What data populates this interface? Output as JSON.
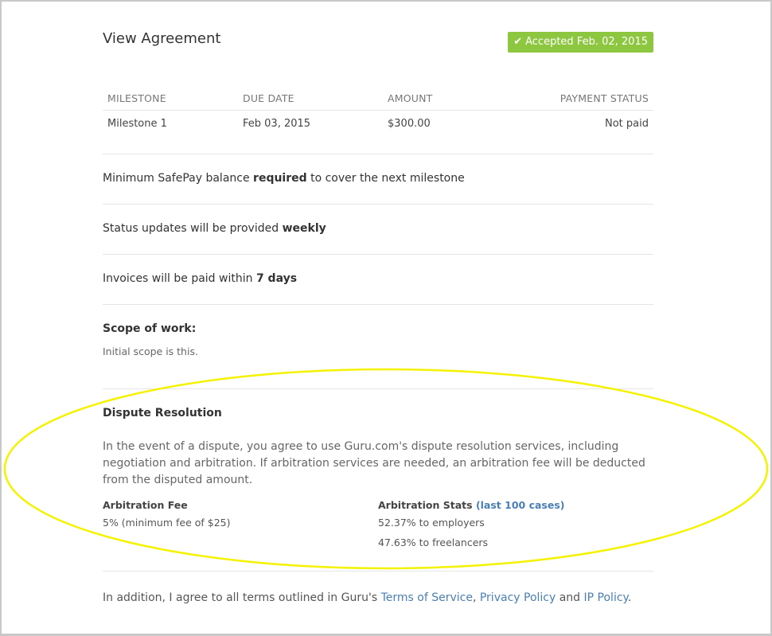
{
  "page": {
    "title": "View Agreement",
    "status_badge": {
      "icon": "check-icon",
      "text": "Accepted Feb. 02, 2015",
      "color": "#8dc63f"
    }
  },
  "milestones": {
    "headers": [
      "MILESTONE",
      "DUE DATE",
      "AMOUNT",
      "PAYMENT STATUS"
    ],
    "rows": [
      {
        "milestone": "Milestone 1",
        "due_date": "Feb 03, 2015",
        "amount": "$300.00",
        "payment_status": "Not paid"
      }
    ]
  },
  "terms": {
    "safepay": {
      "pre": "Minimum SafePay balance ",
      "bold": "required",
      "post": " to cover the next milestone"
    },
    "status_updates": {
      "pre": "Status updates will be provided ",
      "bold": "weekly"
    },
    "invoices": {
      "pre": "Invoices will be paid within ",
      "bold": "7 days"
    }
  },
  "scope": {
    "title": "Scope of work:",
    "text": "Initial scope is this."
  },
  "dispute": {
    "title": "Dispute Resolution",
    "text": "In the event of a dispute, you agree to use Guru.com's dispute resolution services, including negotiation and arbitration. If arbitration services are needed, an arbitration fee will be deducted from the disputed amount.",
    "fee_label": "Arbitration Fee",
    "fee_value": "5% (minimum fee of $25)",
    "stats_label": "Arbitration Stats",
    "stats_link": "(last 100 cases)",
    "stats_employers": "52.37% to employers",
    "stats_freelancers": "47.63% to freelancers"
  },
  "footer": {
    "pre": "In addition, I agree to all terms outlined in Guru's ",
    "terms_link": "Terms of Service",
    "sep1": ", ",
    "privacy_link": "Privacy Policy",
    "sep2": " and ",
    "ip_link": "IP Policy",
    "end": "."
  },
  "colors": {
    "accent_green": "#8dc63f",
    "link_blue": "#4a7fb5",
    "highlight_yellow": "#f5f200"
  }
}
